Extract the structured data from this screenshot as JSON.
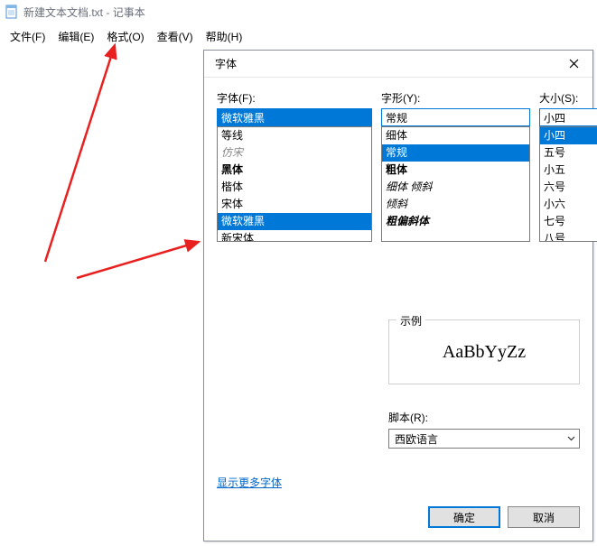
{
  "notepad": {
    "title_doc": "新建文本文档.txt",
    "title_app": "记事本",
    "menu": {
      "file": "文件(F)",
      "edit": "编辑(E)",
      "format": "格式(O)",
      "view": "查看(V)",
      "help": "帮助(H)"
    }
  },
  "dialog": {
    "title": "字体",
    "font_label": "字体(F):",
    "font_value": "微软雅黑",
    "font_list": [
      "等线",
      "仿宋",
      "黑体",
      "楷体",
      "宋体",
      "微软雅黑",
      "新宋体"
    ],
    "style_label": "字形(Y):",
    "style_value": "常规",
    "style_list": [
      "细体",
      "常规",
      "粗体",
      "细体 倾斜",
      "倾斜",
      "粗偏斜体"
    ],
    "size_label": "大小(S):",
    "size_value": "小四",
    "size_list": [
      "小四",
      "五号",
      "小五",
      "六号",
      "小六",
      "七号",
      "八号"
    ],
    "sample_label": "示例",
    "sample_text": "AaBbYyZz",
    "script_label": "脚本(R):",
    "script_value": "西欧语言",
    "more_fonts_link": "显示更多字体",
    "ok": "确定",
    "cancel": "取消"
  }
}
